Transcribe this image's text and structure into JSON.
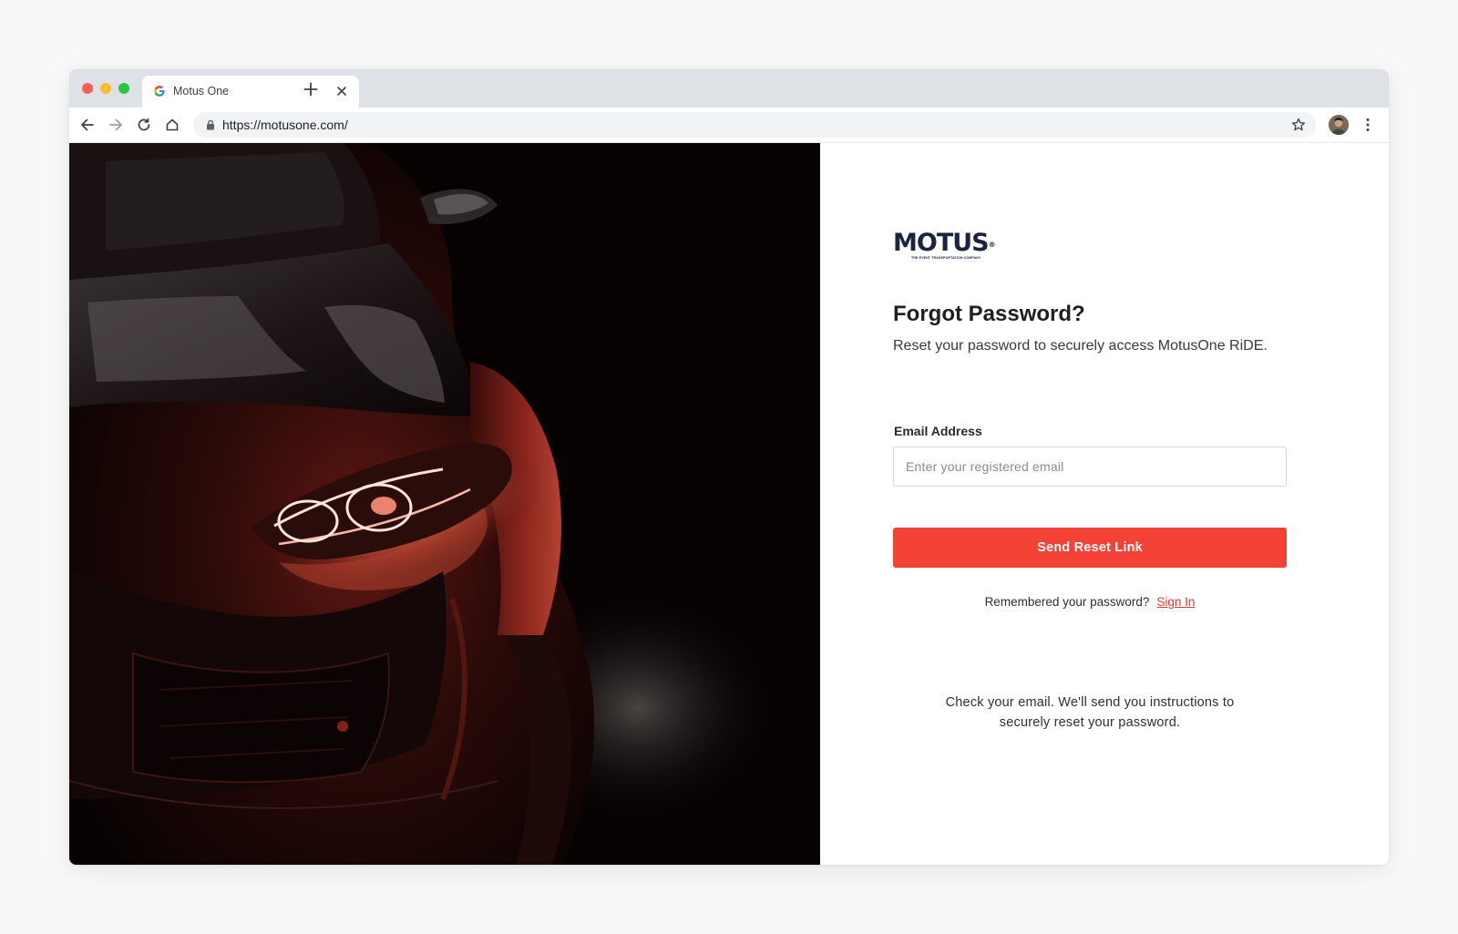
{
  "browser": {
    "tab_title": "Motus One",
    "url": "https://motusone.com/"
  },
  "icons": {
    "tab_favicon": "google-g-icon",
    "tab_close": "close-icon",
    "new_tab": "plus-icon",
    "back": "arrow-left-icon",
    "forward": "arrow-right-icon",
    "reload": "reload-icon",
    "home": "home-icon",
    "lock": "lock-icon",
    "bookmark": "star-icon",
    "menu": "kebab-icon"
  },
  "brand": {
    "logo_text": "MOTUS",
    "logo_tagline": "THE EVENT TRANSPORTATION COMPANY",
    "primary_color": "#f44336",
    "navy_color": "#1b2340"
  },
  "form": {
    "heading": "Forgot Password?",
    "subheading": "Reset your password to securely access MotusOne RiDE.",
    "email_label": "Email Address",
    "email_placeholder": "Enter your registered email",
    "email_value": "",
    "submit_label": "Send Reset Link",
    "remember_text": "Remembered your password?",
    "signin_label": "Sign In",
    "info_line1": "Check your email. We'll send you instructions to",
    "info_line2": "securely reset your password."
  }
}
